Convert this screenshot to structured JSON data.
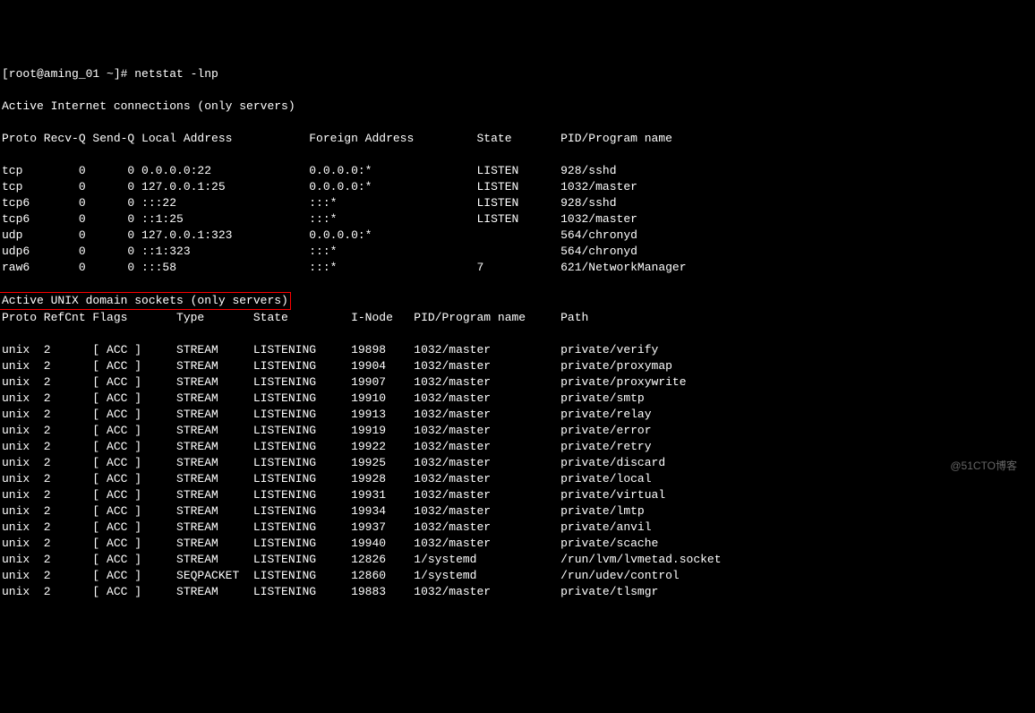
{
  "prompt": "[root@aming_01 ~]# netstat -lnp",
  "section1_header": "Active Internet connections (only servers)",
  "internet_cols": "Proto Recv-Q Send-Q Local Address           Foreign Address         State       PID/Program name   ",
  "internet_rows": [
    "tcp        0      0 0.0.0.0:22              0.0.0.0:*               LISTEN      928/sshd           ",
    "tcp        0      0 127.0.0.1:25            0.0.0.0:*               LISTEN      1032/master        ",
    "tcp6       0      0 :::22                   :::*                    LISTEN      928/sshd           ",
    "tcp6       0      0 ::1:25                  :::*                    LISTEN      1032/master        ",
    "udp        0      0 127.0.0.1:323           0.0.0.0:*                           564/chronyd        ",
    "udp6       0      0 ::1:323                 :::*                                564/chronyd        ",
    "raw6       0      0 :::58                   :::*                    7           621/NetworkManager "
  ],
  "section2_header": "Active UNIX domain sockets (only servers)",
  "unix_cols": "Proto RefCnt Flags       Type       State         I-Node   PID/Program name     Path",
  "unix_rows": [
    "unix  2      [ ACC ]     STREAM     LISTENING     19898    1032/master          private/verify",
    "unix  2      [ ACC ]     STREAM     LISTENING     19904    1032/master          private/proxymap",
    "unix  2      [ ACC ]     STREAM     LISTENING     19907    1032/master          private/proxywrite",
    "unix  2      [ ACC ]     STREAM     LISTENING     19910    1032/master          private/smtp",
    "unix  2      [ ACC ]     STREAM     LISTENING     19913    1032/master          private/relay",
    "unix  2      [ ACC ]     STREAM     LISTENING     19919    1032/master          private/error",
    "unix  2      [ ACC ]     STREAM     LISTENING     19922    1032/master          private/retry",
    "unix  2      [ ACC ]     STREAM     LISTENING     19925    1032/master          private/discard",
    "unix  2      [ ACC ]     STREAM     LISTENING     19928    1032/master          private/local",
    "unix  2      [ ACC ]     STREAM     LISTENING     19931    1032/master          private/virtual",
    "unix  2      [ ACC ]     STREAM     LISTENING     19934    1032/master          private/lmtp",
    "unix  2      [ ACC ]     STREAM     LISTENING     19937    1032/master          private/anvil",
    "unix  2      [ ACC ]     STREAM     LISTENING     19940    1032/master          private/scache",
    "unix  2      [ ACC ]     STREAM     LISTENING     12826    1/systemd            /run/lvm/lvmetad.socket",
    "unix  2      [ ACC ]     SEQPACKET  LISTENING     12860    1/systemd            /run/udev/control",
    "unix  2      [ ACC ]     STREAM     LISTENING     19883    1032/master          private/tlsmgr"
  ],
  "watermark": "@51CTO博客"
}
